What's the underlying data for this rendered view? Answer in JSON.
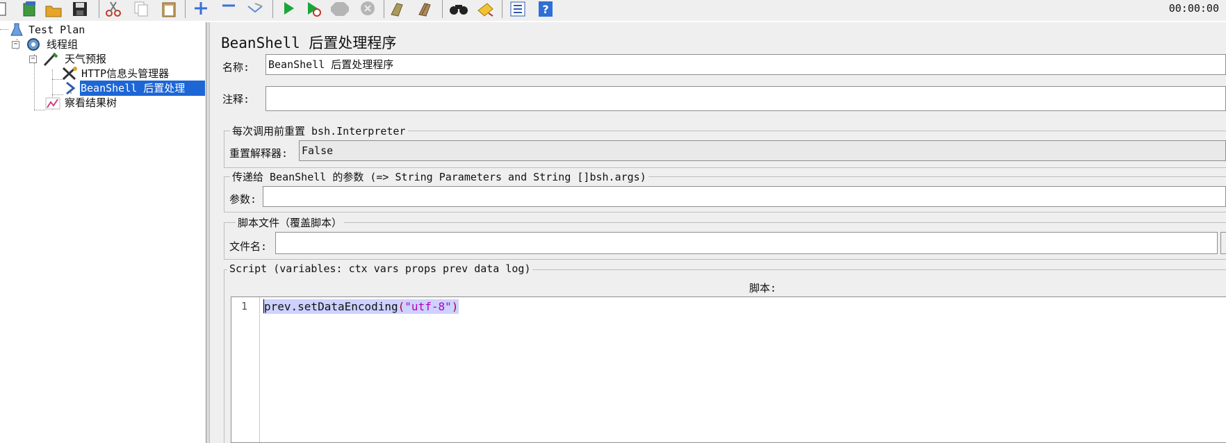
{
  "toolbar": {
    "icons": [
      "new-icon",
      "templates-icon",
      "open-icon",
      "save-icon",
      "cut-icon",
      "copy-icon",
      "paste-icon",
      "expand-icon",
      "collapse-icon",
      "toggle-icon",
      "start-icon",
      "start-no-pause-icon",
      "stop-icon",
      "shutdown-icon",
      "clear-icon",
      "clear-all-icon",
      "search-icon",
      "reset-search-icon",
      "function-helper-icon",
      "help-icon"
    ],
    "timer": "00:00:00"
  },
  "tree": {
    "items": [
      {
        "label": "Test Plan"
      },
      {
        "label": "线程组"
      },
      {
        "label": "天气预报"
      },
      {
        "label": "HTTP信息头管理器"
      },
      {
        "label": "BeanShell 后置处理"
      },
      {
        "label": "察看结果树"
      }
    ]
  },
  "panel": {
    "title": "BeanShell 后置处理程序",
    "name_label": "名称:",
    "name_value": "BeanShell 后置处理程序",
    "comment_label": "注释:",
    "comment_value": "",
    "reset_group": {
      "legend": "每次调用前重置 bsh.Interpreter",
      "label": "重置解释器:",
      "value": "False"
    },
    "params_group": {
      "legend": "传递给 BeanShell 的参数 (=> String Parameters and String []bsh.args)",
      "label": "参数:",
      "value": ""
    },
    "file_group": {
      "legend": "脚本文件（覆盖脚本）",
      "label": "文件名:",
      "value": ""
    },
    "script_group": {
      "legend": "Script (variables: ctx vars props prev data log)",
      "label": "脚本:",
      "line_number": "1",
      "code_method": "prev.setDataEncoding",
      "code_open": "(",
      "code_string": "\"utf-8\"",
      "code_close": ")"
    }
  }
}
